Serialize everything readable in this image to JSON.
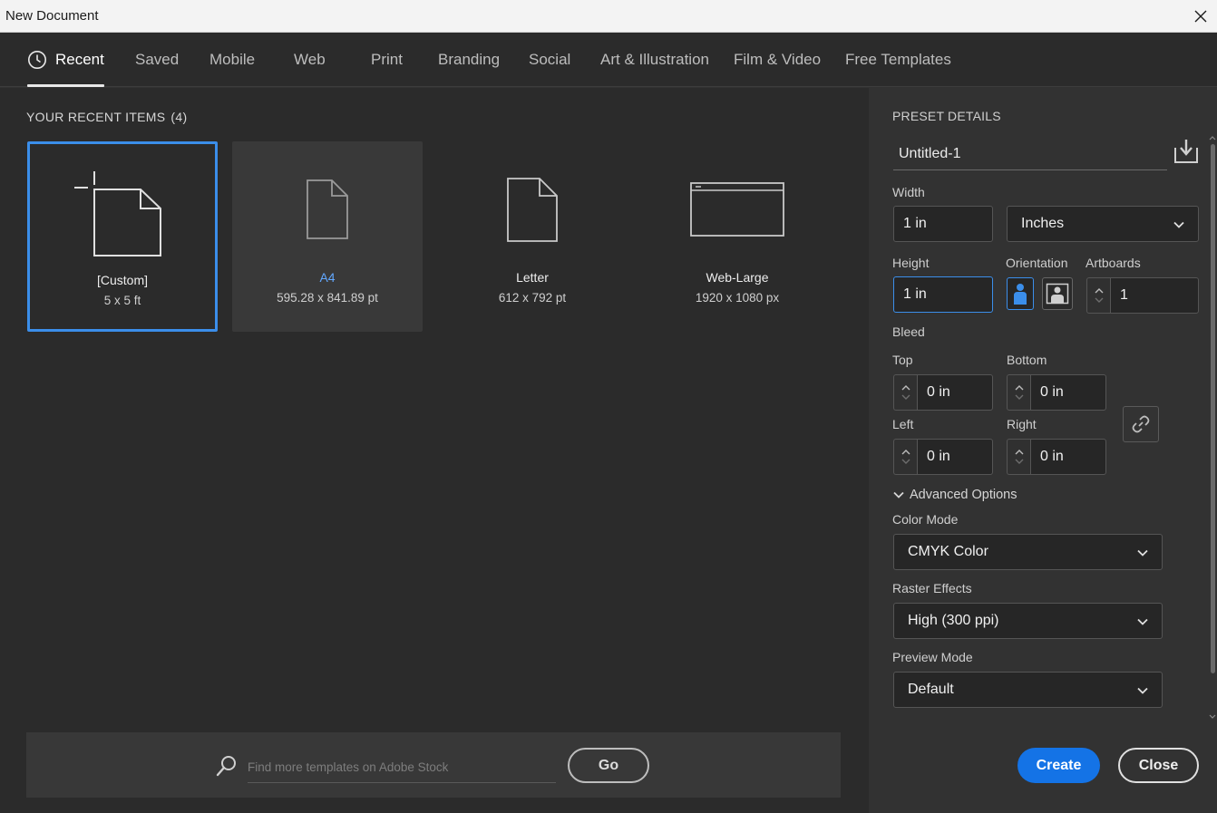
{
  "window": {
    "title": "New Document"
  },
  "tabs": [
    {
      "label": "Recent",
      "icon": "clock-icon",
      "active": true
    },
    {
      "label": "Saved"
    },
    {
      "label": "Mobile"
    },
    {
      "label": "Web"
    },
    {
      "label": "Print"
    },
    {
      "label": "Branding"
    },
    {
      "label": "Social"
    },
    {
      "label": "Art & Illustration"
    },
    {
      "label": "Film & Video"
    },
    {
      "label": "Free Templates"
    }
  ],
  "recent": {
    "heading": "YOUR RECENT ITEMS",
    "count": "(4)",
    "items": [
      {
        "name": "[Custom]",
        "dims": "5 x 5 ft",
        "icon": "custom-document-icon",
        "selected": true
      },
      {
        "name": "A4",
        "dims": "595.28 x 841.89 pt",
        "icon": "document-icon"
      },
      {
        "name": "Letter",
        "dims": "612 x 792 pt",
        "icon": "document-icon"
      },
      {
        "name": "Web-Large",
        "dims": "1920 x 1080 px",
        "icon": "browser-window-icon"
      }
    ]
  },
  "stock": {
    "placeholder": "Find more templates on Adobe Stock",
    "go_label": "Go"
  },
  "preset": {
    "title": "PRESET DETAILS",
    "name": "Untitled-1",
    "width_label": "Width",
    "width": "1 in",
    "units": "Inches",
    "height_label": "Height",
    "height": "1 in",
    "orientation_label": "Orientation",
    "artboards_label": "Artboards",
    "artboards": "1",
    "bleed_label": "Bleed",
    "top_label": "Top",
    "top": "0 in",
    "bottom_label": "Bottom",
    "bottom": "0 in",
    "left_label": "Left",
    "left": "0 in",
    "right_label": "Right",
    "right": "0 in",
    "advanced_label": "Advanced Options",
    "color_mode_label": "Color Mode",
    "color_mode": "CMYK Color",
    "raster_label": "Raster Effects",
    "raster": "High (300 ppi)",
    "preview_label": "Preview Mode",
    "preview": "Default"
  },
  "actions": {
    "create": "Create",
    "close": "Close"
  },
  "colors": {
    "accent": "#1473e6",
    "selection": "#3b8eea",
    "panel": "#323232",
    "background": "#2b2b2b"
  }
}
